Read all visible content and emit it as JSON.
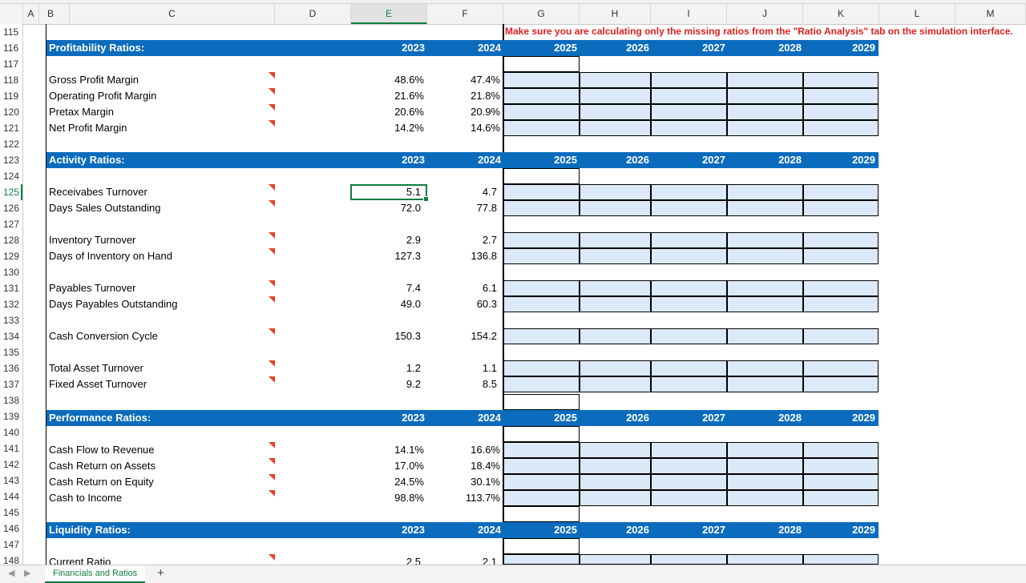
{
  "columns": [
    "A",
    "B",
    "C",
    "D",
    "E",
    "F",
    "G",
    "H",
    "I",
    "J",
    "K",
    "L",
    "M"
  ],
  "selected_column": "E",
  "selected_row": "125",
  "rows": [
    "115",
    "116",
    "117",
    "118",
    "119",
    "120",
    "121",
    "122",
    "123",
    "124",
    "125",
    "126",
    "127",
    "128",
    "129",
    "130",
    "131",
    "132",
    "133",
    "134",
    "135",
    "136",
    "137",
    "138",
    "139",
    "140",
    "141",
    "142",
    "143",
    "144",
    "145",
    "146",
    "147",
    "148"
  ],
  "note": "Make sure you are calculating only the missing ratios from the \"Ratio Analysis\" tab on the simulation interface.",
  "years": [
    "2023",
    "2024",
    "2025",
    "2026",
    "2027",
    "2028",
    "2029"
  ],
  "sections": {
    "profitability": "Profitability Ratios:",
    "activity": "Activity Ratios:",
    "performance": "Performance Ratios:",
    "liquidity": "Liquidity Ratios:"
  },
  "metrics": [
    {
      "label": "Gross Profit Margin",
      "y2023": "48.6%",
      "y2024": "47.4%"
    },
    {
      "label": "Operating Profit Margin",
      "y2023": "21.6%",
      "y2024": "21.8%"
    },
    {
      "label": "Pretax Margin",
      "y2023": "20.6%",
      "y2024": "20.9%"
    },
    {
      "label": "Net Profit Margin",
      "y2023": "14.2%",
      "y2024": "14.6%"
    },
    {
      "label": "Receivabes Turnover",
      "y2023": "5.1",
      "y2024": "4.7"
    },
    {
      "label": "Days Sales Outstanding",
      "y2023": "72.0",
      "y2024": "77.8"
    },
    {
      "label": "Inventory Turnover",
      "y2023": "2.9",
      "y2024": "2.7"
    },
    {
      "label": "Days of Inventory on Hand",
      "y2023": "127.3",
      "y2024": "136.8"
    },
    {
      "label": "Payables Turnover",
      "y2023": "7.4",
      "y2024": "6.1"
    },
    {
      "label": "Days Payables Outstanding",
      "y2023": "49.0",
      "y2024": "60.3"
    },
    {
      "label": "Cash Conversion Cycle",
      "y2023": "150.3",
      "y2024": "154.2"
    },
    {
      "label": "Total Asset Turnover",
      "y2023": "1.2",
      "y2024": "1.1"
    },
    {
      "label": "Fixed Asset Turnover",
      "y2023": "9.2",
      "y2024": "8.5"
    },
    {
      "label": "Cash Flow to Revenue",
      "y2023": "14.1%",
      "y2024": "16.6%"
    },
    {
      "label": "Cash Return on Assets",
      "y2023": "17.0%",
      "y2024": "18.4%"
    },
    {
      "label": "Cash Return on Equity",
      "y2023": "24.5%",
      "y2024": "30.1%"
    },
    {
      "label": "Cash to Income",
      "y2023": "98.8%",
      "y2024": "113.7%"
    },
    {
      "label": "Current Ratio",
      "y2023": "2.5",
      "y2024": "2.1"
    }
  ],
  "sheet_tab": "Financials and Ratios",
  "add_sheet_symbol": "+",
  "nav_prev": "◀",
  "nav_next": "▶",
  "colors": {
    "header_blue": "#0b6cbd",
    "input_blue": "#dce9f8",
    "note_red": "#e02020",
    "select_green": "#107c41"
  }
}
